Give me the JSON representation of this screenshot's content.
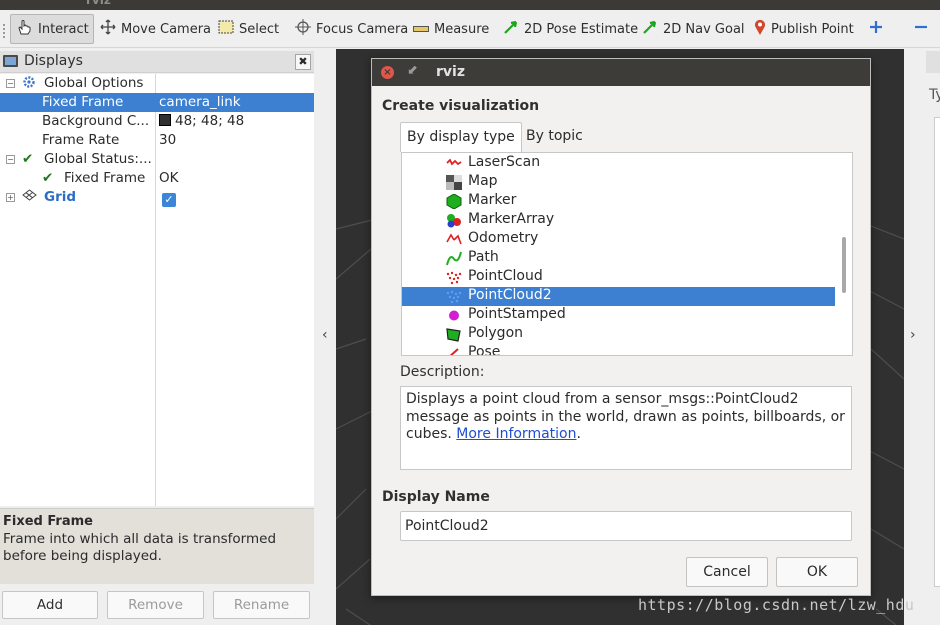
{
  "window_title": "rviz",
  "toolbar": {
    "tools": [
      {
        "label": "Interact",
        "icon": "hand-pointer-icon",
        "active": true
      },
      {
        "label": "Move Camera",
        "icon": "move-camera-icon"
      },
      {
        "label": "Select",
        "icon": "select-rectangle-icon"
      },
      {
        "label": "Focus Camera",
        "icon": "focus-camera-icon"
      },
      {
        "label": "Measure",
        "icon": "ruler-icon"
      },
      {
        "label": "2D Pose Estimate",
        "icon": "green-arrow-icon"
      },
      {
        "label": "2D Nav Goal",
        "icon": "green-arrow-icon"
      },
      {
        "label": "Publish Point",
        "icon": "map-pin-icon"
      }
    ]
  },
  "displays": {
    "title": "Displays",
    "rows": [
      {
        "label": "Global Options",
        "value": ""
      },
      {
        "label": "Fixed Frame",
        "value": "camera_link"
      },
      {
        "label": "Background C...",
        "value": "48; 48; 48"
      },
      {
        "label": "Frame Rate",
        "value": "30"
      },
      {
        "label": "Global Status:...",
        "value": ""
      },
      {
        "label": "Fixed Frame",
        "value": "OK"
      },
      {
        "label": "Grid",
        "value": ""
      }
    ],
    "description_heading": "Fixed Frame",
    "description_text": "Frame into which all data is transformed before being displayed.",
    "buttons": {
      "add": "Add",
      "remove": "Remove",
      "rename": "Rename"
    }
  },
  "dialog": {
    "title": "rviz",
    "heading": "Create visualization",
    "tabs": [
      "By display type",
      "By topic"
    ],
    "items": [
      {
        "label": "LaserScan",
        "icon": "laserscan-icon"
      },
      {
        "label": "Map",
        "icon": "map-icon"
      },
      {
        "label": "Marker",
        "icon": "marker-icon"
      },
      {
        "label": "MarkerArray",
        "icon": "marker-array-icon"
      },
      {
        "label": "Odometry",
        "icon": "odometry-icon"
      },
      {
        "label": "Path",
        "icon": "path-icon"
      },
      {
        "label": "PointCloud",
        "icon": "pointcloud-icon"
      },
      {
        "label": "PointCloud2",
        "icon": "pointcloud2-icon",
        "selected": true
      },
      {
        "label": "PointStamped",
        "icon": "pointstamped-icon"
      },
      {
        "label": "Polygon",
        "icon": "polygon-icon"
      },
      {
        "label": "Pose",
        "icon": "pose-icon"
      }
    ],
    "description_label": "Description:",
    "description_text": "Displays a point cloud from a sensor_msgs::PointCloud2 message as points in the world, drawn as points, billboards, or cubes.",
    "more_info_link": "More Information",
    "display_name_label": "Display Name",
    "display_name_value": "PointCloud2",
    "cancel": "Cancel",
    "ok": "OK"
  },
  "right_panel": {
    "label_fragment": "Ty"
  },
  "watermark": "https://blog.csdn.net/lzw_hdu",
  "colors": {
    "selection": "#3d7fd0",
    "view_background": "#303030",
    "titlebar": "#3d3c38"
  }
}
